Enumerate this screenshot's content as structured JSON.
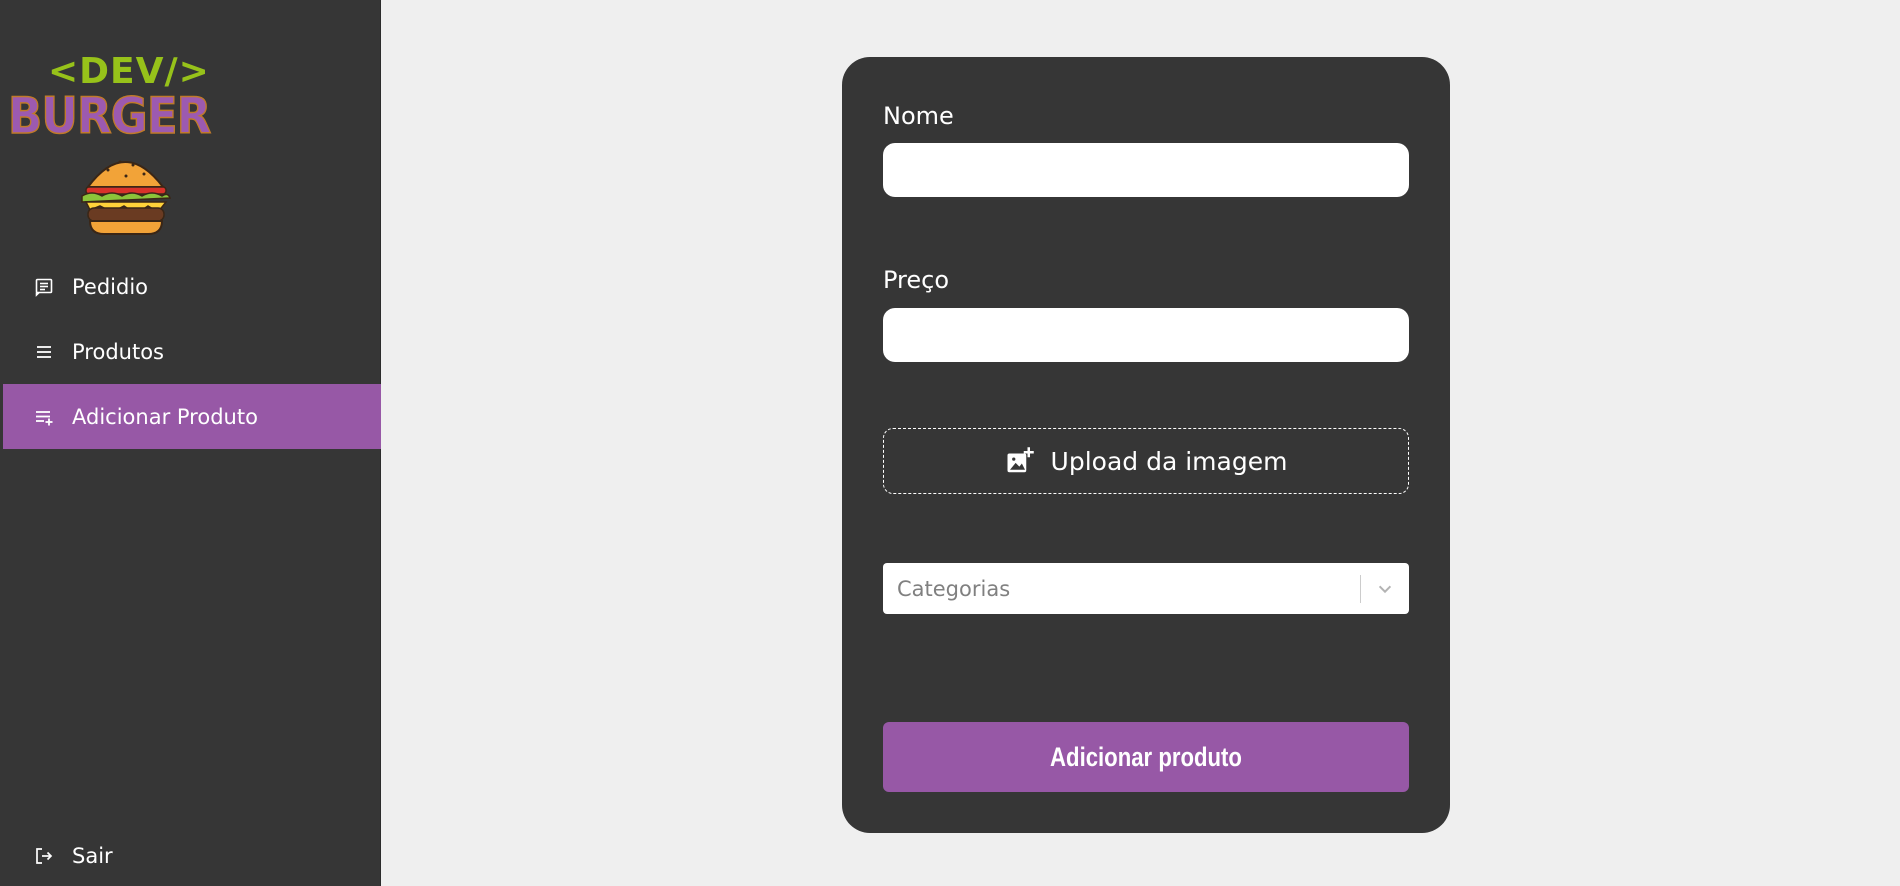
{
  "brand": {
    "code_tag": "<DEV/>",
    "wordmark": "BURGER"
  },
  "sidebar": {
    "items": [
      {
        "label": "Pedidio",
        "icon": "receipt-icon",
        "active": false
      },
      {
        "label": "Produtos",
        "icon": "list-icon",
        "active": false
      },
      {
        "label": "Adicionar Produto",
        "icon": "playlist-add-icon",
        "active": true
      }
    ],
    "logout": {
      "label": "Sair",
      "icon": "logout-icon"
    }
  },
  "form": {
    "name_label": "Nome",
    "name_value": "",
    "price_label": "Preço",
    "price_value": "",
    "upload_label": "Upload da imagem",
    "category_placeholder": "Categorias",
    "submit_label": "Adicionar produto"
  },
  "colors": {
    "accent": "#9758a6",
    "sidebar_bg": "#363636",
    "page_bg": "#efefef",
    "logo_green": "#97c21a"
  }
}
